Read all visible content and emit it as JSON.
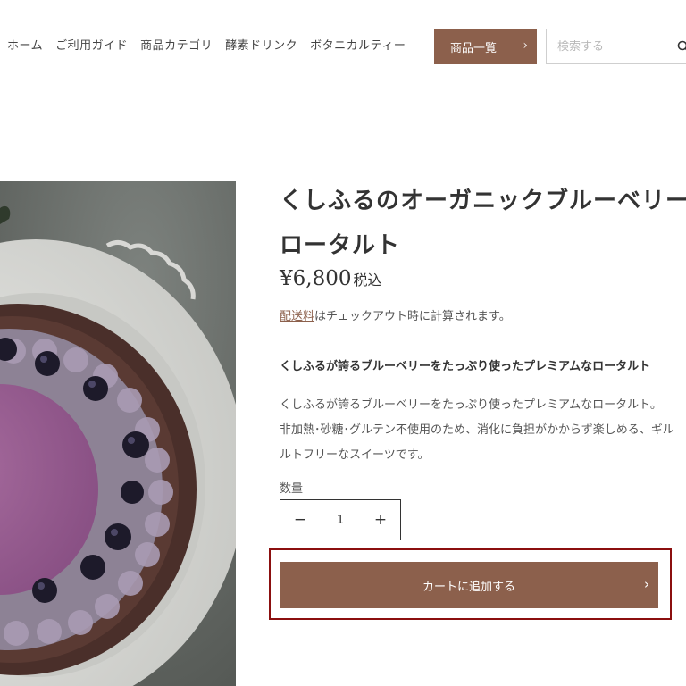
{
  "nav": {
    "items": [
      "ホーム",
      "ご利用ガイド",
      "商品カテゴリ",
      "酵素ドリンク",
      "ボタニカルティー"
    ]
  },
  "header": {
    "products_label": "商品一覧",
    "search_placeholder": "検索する"
  },
  "product": {
    "title": "くしふるのオーガニックブルーベリーロータルト",
    "price": "¥6,800",
    "tax_label": "税込",
    "shipping_link": "配送料",
    "shipping_text": "はチェックアウト時に計算されます。",
    "headline": "くしふるが誇るブルーベリーをたっぷり使ったプレミアムなロータルト",
    "description": [
      "くしふるが誇るブルーベリーをたっぷり使ったプレミアムなロータルト。",
      "非加熱･砂糖･グルテン不使用のため、消化に負担がかからず楽しめる、ギル",
      "ルトフリーなスイーツです。"
    ],
    "quantity_label": "数量",
    "quantity_value": "1",
    "add_to_cart_label": "カートに追加する"
  },
  "colors": {
    "accent": "#8c604c",
    "highlight": "#8b0f0f"
  }
}
